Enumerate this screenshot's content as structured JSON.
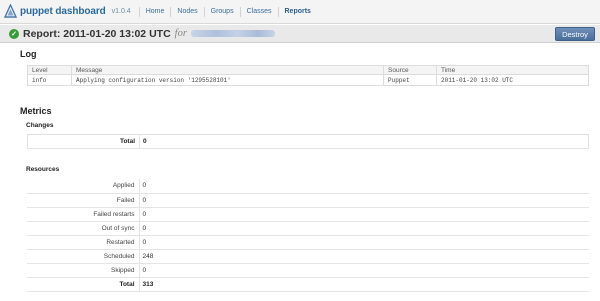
{
  "nav": {
    "brand": "puppet dashboard",
    "version": "v1.0.4",
    "links": [
      "Home",
      "Nodes",
      "Groups",
      "Classes",
      "Reports"
    ],
    "active": "Reports"
  },
  "header": {
    "title": "Report: 2011-01-20 13:02 UTC",
    "for_word": "for",
    "destroy_label": "Destroy"
  },
  "log": {
    "heading": "Log",
    "columns": [
      "Level",
      "Message",
      "Source",
      "Time"
    ],
    "rows": [
      [
        "info",
        "Applying configuration version '1295528101'",
        "Puppet",
        "2011-01-20 13:02 UTC"
      ]
    ]
  },
  "metrics": {
    "heading": "Metrics",
    "changes": {
      "heading": "Changes",
      "rows": [
        {
          "label": "Total",
          "value": "0"
        }
      ]
    },
    "resources": {
      "heading": "Resources",
      "rows": [
        {
          "label": "Applied",
          "value": "0"
        },
        {
          "label": "Failed",
          "value": "0"
        },
        {
          "label": "Failed restarts",
          "value": "0"
        },
        {
          "label": "Out of sync",
          "value": "0"
        },
        {
          "label": "Restarted",
          "value": "0"
        },
        {
          "label": "Scheduled",
          "value": "248"
        },
        {
          "label": "Skipped",
          "value": "0"
        },
        {
          "label": "Total",
          "value": "313"
        }
      ]
    }
  },
  "colors": {
    "brand": "#2a6a9a",
    "link": "#3b6e9e",
    "success": "#3a9a3a",
    "button": "#4a6f9b"
  }
}
